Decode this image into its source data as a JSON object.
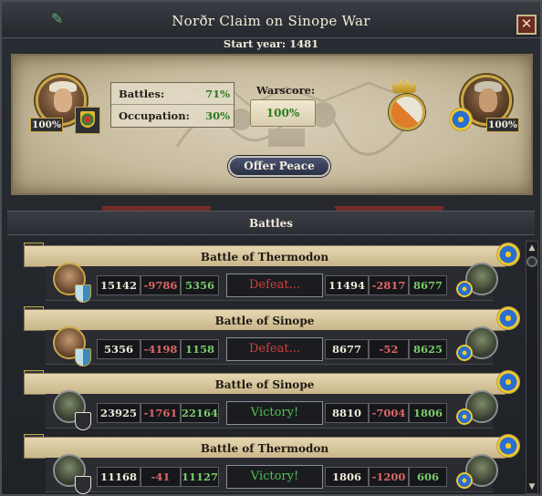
{
  "window": {
    "title": "Norðr Claim on Sinope War",
    "close_label": "✕",
    "start_year_text": "Start year: 1481"
  },
  "summary": {
    "attacker_strength": "100%",
    "defender_strength": "100%",
    "battles_label": "Battles:",
    "battles_value": "71%",
    "occupation_label": "Occupation:",
    "occupation_value": "30%",
    "warscore_label": "Warscore:",
    "warscore_value": "100%",
    "offer_peace_label": "Offer Peace"
  },
  "battles_section": {
    "title": "Battles",
    "items": [
      {
        "name": "Battle of Thermodon",
        "our_troops": "15142",
        "our_losses": "-9786",
        "our_remaining": "5356",
        "result": "Defeat...",
        "result_type": "defeat",
        "their_troops": "11494",
        "their_losses": "-2817",
        "their_remaining": "8677"
      },
      {
        "name": "Battle of Sinope",
        "our_troops": "5356",
        "our_losses": "-4198",
        "our_remaining": "1158",
        "result": "Defeat...",
        "result_type": "defeat",
        "their_troops": "8677",
        "their_losses": "-52",
        "their_remaining": "8625"
      },
      {
        "name": "Battle of Sinope",
        "our_troops": "23925",
        "our_losses": "-1761",
        "our_remaining": "22164",
        "result": "Victory!",
        "result_type": "victory",
        "their_troops": "8810",
        "their_losses": "-7004",
        "their_remaining": "1806"
      },
      {
        "name": "Battle of Thermodon",
        "our_troops": "11168",
        "our_losses": "-41",
        "our_remaining": "11127",
        "result": "Victory!",
        "result_type": "victory",
        "their_troops": "1806",
        "their_losses": "-1200",
        "their_remaining": "606"
      }
    ]
  },
  "colors": {
    "positive": "#7ccc6a",
    "negative": "#e06666",
    "defeat": "#d0403a",
    "victory": "#4cc44a",
    "gold_trim": "#c9a647"
  },
  "icons": {
    "attacker_flag": "attacker-flag-icon",
    "defender_flag": "defender-flag-icon",
    "war_goal": "war-goal-shield-icon",
    "crown": "crown-icon"
  }
}
